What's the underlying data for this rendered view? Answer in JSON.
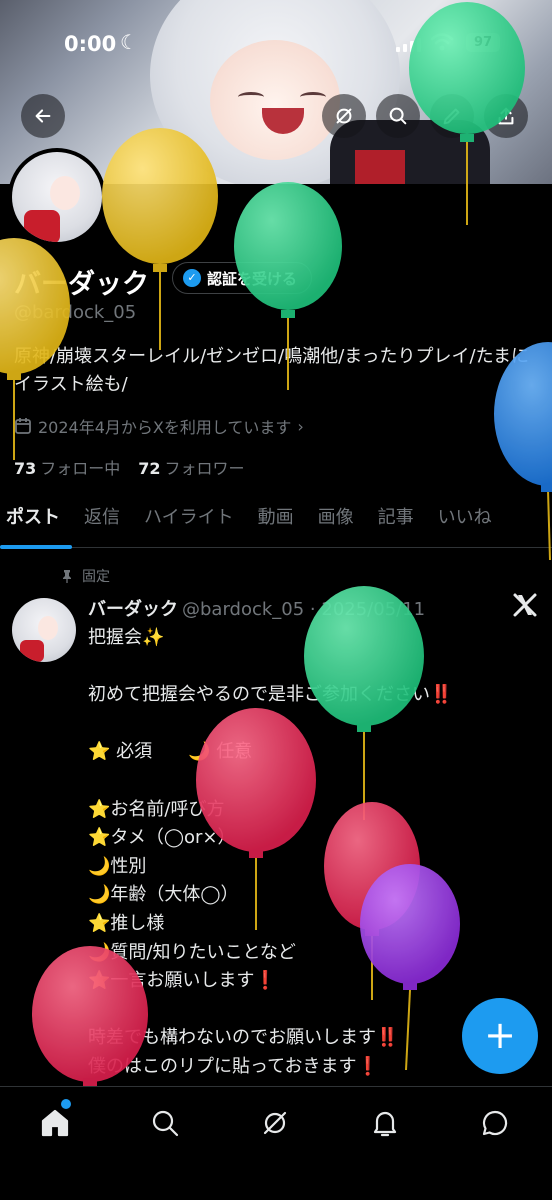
{
  "status": {
    "time": "0:00",
    "battery": "97"
  },
  "profile": {
    "name": "バーダック",
    "verify_label": "認証を受ける",
    "handle": "@bardock_05",
    "bio": "原神/崩壊スターレイル/ゼンゼロ/鳴潮他/まったりプレイ/たまにイラスト絵も/",
    "joined": "2024年4月からXを利用しています",
    "following_count": "73",
    "following_label": "フォロー中",
    "followers_count": "72",
    "followers_label": "フォロワー"
  },
  "tabs": [
    "ポスト",
    "返信",
    "ハイライト",
    "動画",
    "画像",
    "記事",
    "いいね"
  ],
  "post": {
    "pinned_label": "固定",
    "author": "バーダック",
    "meta": "@bardock_05 · 2025/05/11",
    "body": "把握会✨\n\n初めて把握会やるので是非ご参加ください‼️\n\n⭐ 必須　　🌙 任意\n\n⭐お名前/呼び方\n⭐タメ（◯or×）\n🌙性別\n🌙年齢（大体◯）\n⭐推し様\n🌙質問/知りたいことなど\n⭐一言お願いします❗\n\n時差でも構わないのでお願いします‼️\n僕のはこのリプに貼っておきます❗"
  },
  "fab_label": "+",
  "icons": {
    "back": "back-arrow-icon",
    "grok": "grok-icon",
    "search": "search-icon",
    "edit": "pencil-icon",
    "share": "share-icon",
    "home": "home-icon",
    "notifications": "bell-icon",
    "messages": "message-icon"
  },
  "colors": {
    "accent": "#1d9bf0",
    "background": "#000000"
  },
  "balloons": [
    "green",
    "yellow",
    "green",
    "yellow",
    "blue",
    "green",
    "red",
    "red",
    "purple",
    "red"
  ]
}
